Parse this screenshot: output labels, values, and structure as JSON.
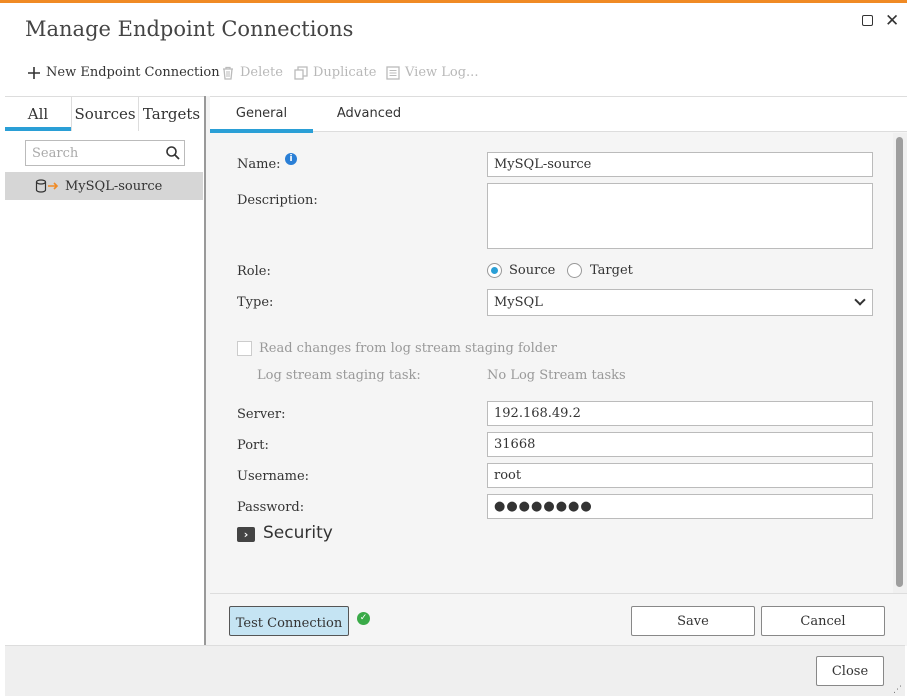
{
  "dialog": {
    "title": "Manage Endpoint Connections"
  },
  "toolbar": {
    "new_label": "New Endpoint Connection",
    "delete_label": "Delete",
    "duplicate_label": "Duplicate",
    "viewlog_label": "View Log..."
  },
  "left_panel": {
    "tabs": [
      {
        "label": "All"
      },
      {
        "label": "Sources"
      },
      {
        "label": "Targets"
      }
    ],
    "search_placeholder": "Search",
    "endpoints": [
      {
        "name": "MySQL-source",
        "icon": "database-source-icon"
      }
    ]
  },
  "right_panel": {
    "tabs": [
      {
        "label": "General"
      },
      {
        "label": "Advanced"
      }
    ],
    "fields": {
      "name_label": "Name:",
      "name_value": "MySQL-source",
      "description_label": "Description:",
      "description_value": "",
      "role_label": "Role:",
      "role_source": "Source",
      "role_target": "Target",
      "role_selected": "Source",
      "type_label": "Type:",
      "type_value": "MySQL",
      "read_changes_label": "Read changes from log stream staging folder",
      "staging_task_label": "Log stream staging task:",
      "staging_task_value": "No Log Stream tasks",
      "server_label": "Server:",
      "server_value": "192.168.49.2",
      "port_label": "Port:",
      "port_value": "31668",
      "username_label": "Username:",
      "username_value": "root",
      "password_label": "Password:",
      "password_value": "●●●●●●●●",
      "security_label": "Security"
    },
    "buttons": {
      "test_connection": "Test Connection",
      "save": "Save",
      "cancel": "Cancel"
    }
  },
  "footer": {
    "close": "Close"
  },
  "colors": {
    "accent": "#2a9fd6",
    "title_bar": "#f08a24",
    "success": "#3aaa48"
  }
}
